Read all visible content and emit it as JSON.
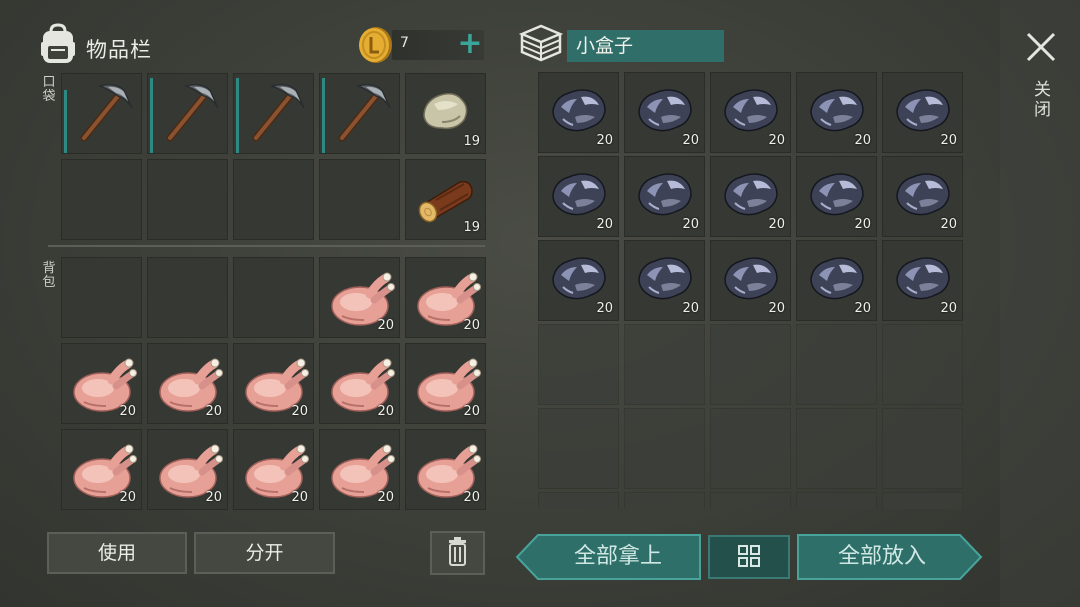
{
  "inventory": {
    "title": "物品栏",
    "coins": "7",
    "add_symbol": "+",
    "pocket_label": "口袋",
    "backpack_label": "背包"
  },
  "pocket_slots": [
    {
      "item": "pickaxe",
      "qty": "",
      "durability": 0.82
    },
    {
      "item": "pickaxe",
      "qty": "",
      "durability": 0.98
    },
    {
      "item": "pickaxe",
      "qty": "",
      "durability": 0.98
    },
    {
      "item": "pickaxe",
      "qty": "",
      "durability": 0.98
    },
    {
      "item": "stone",
      "qty": "19"
    },
    {
      "item": "",
      "qty": ""
    },
    {
      "item": "",
      "qty": ""
    },
    {
      "item": "",
      "qty": ""
    },
    {
      "item": "",
      "qty": ""
    },
    {
      "item": "log",
      "qty": "19"
    }
  ],
  "backpack_slots": [
    {
      "item": "",
      "qty": ""
    },
    {
      "item": "",
      "qty": ""
    },
    {
      "item": "",
      "qty": ""
    },
    {
      "item": "chicken",
      "qty": "20"
    },
    {
      "item": "chicken",
      "qty": "20"
    },
    {
      "item": "chicken",
      "qty": "20"
    },
    {
      "item": "chicken",
      "qty": "20"
    },
    {
      "item": "chicken",
      "qty": "20"
    },
    {
      "item": "chicken",
      "qty": "20"
    },
    {
      "item": "chicken",
      "qty": "20"
    },
    {
      "item": "chicken",
      "qty": "20"
    },
    {
      "item": "chicken",
      "qty": "20"
    },
    {
      "item": "chicken",
      "qty": "20"
    },
    {
      "item": "chicken",
      "qty": "20"
    },
    {
      "item": "chicken",
      "qty": "20"
    }
  ],
  "actions": {
    "use_label": "使用",
    "split_label": "分开"
  },
  "box": {
    "name": "小盒子",
    "take_all_label": "全部拿上",
    "put_all_label": "全部放入",
    "slots": [
      {
        "item": "iron-ore",
        "qty": "20"
      },
      {
        "item": "iron-ore",
        "qty": "20"
      },
      {
        "item": "iron-ore",
        "qty": "20"
      },
      {
        "item": "iron-ore",
        "qty": "20"
      },
      {
        "item": "iron-ore",
        "qty": "20"
      },
      {
        "item": "iron-ore",
        "qty": "20"
      },
      {
        "item": "iron-ore",
        "qty": "20"
      },
      {
        "item": "iron-ore",
        "qty": "20"
      },
      {
        "item": "iron-ore",
        "qty": "20"
      },
      {
        "item": "iron-ore",
        "qty": "20"
      },
      {
        "item": "iron-ore",
        "qty": "20"
      },
      {
        "item": "iron-ore",
        "qty": "20"
      },
      {
        "item": "iron-ore",
        "qty": "20"
      },
      {
        "item": "iron-ore",
        "qty": "20"
      },
      {
        "item": "iron-ore",
        "qty": "20"
      },
      {
        "item": "",
        "qty": ""
      },
      {
        "item": "",
        "qty": ""
      },
      {
        "item": "",
        "qty": ""
      },
      {
        "item": "",
        "qty": ""
      },
      {
        "item": "",
        "qty": ""
      },
      {
        "item": "",
        "qty": ""
      },
      {
        "item": "",
        "qty": ""
      },
      {
        "item": "",
        "qty": ""
      },
      {
        "item": "",
        "qty": ""
      },
      {
        "item": "",
        "qty": ""
      },
      {
        "item": "",
        "qty": ""
      },
      {
        "item": "",
        "qty": ""
      },
      {
        "item": "",
        "qty": ""
      },
      {
        "item": "",
        "qty": ""
      },
      {
        "item": "",
        "qty": ""
      }
    ]
  },
  "close_label": "关闭",
  "colors": {
    "accent": "#2f6f6a",
    "durability": "#2c8a82",
    "coin": "#e0a92c"
  }
}
